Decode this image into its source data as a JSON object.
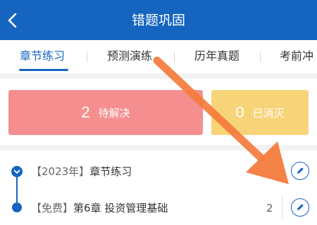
{
  "header": {
    "title": "错题巩固",
    "back_icon": "chevron-left-icon"
  },
  "tabs": [
    {
      "label": "章节练习",
      "active": true
    },
    {
      "label": "预测演练",
      "active": false
    },
    {
      "label": "历年真题",
      "active": false
    },
    {
      "label": "考前冲",
      "active": false
    }
  ],
  "stats": {
    "pending": {
      "count": "2",
      "label": "待解决",
      "color": "#f58f8f"
    },
    "cleared": {
      "count": "0",
      "label": "已消灭",
      "color": "#f8d478"
    }
  },
  "list": {
    "group": {
      "tag": "【2023年】",
      "title": "章节练习",
      "icon": "edit-icon"
    },
    "item": {
      "tag": "【免费】",
      "title": "第6章 投资管理基础",
      "count": "2",
      "icon": "edit-icon"
    }
  },
  "colors": {
    "primary": "#1565c0",
    "annotation_arrow": "#f47b3c"
  }
}
